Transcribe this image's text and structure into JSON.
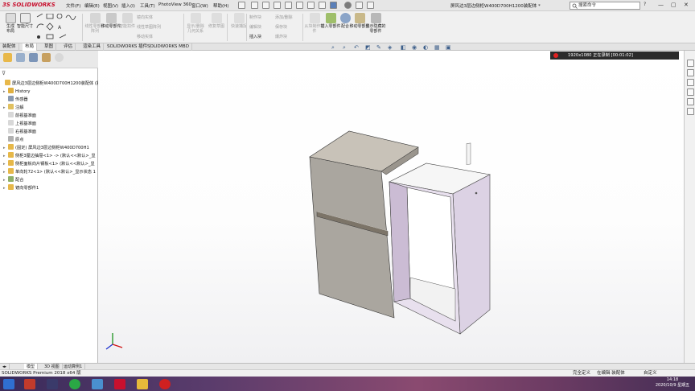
{
  "app": {
    "logo_ds": "3S",
    "logo_text": "SOLIDWORKS",
    "doc_title": "屏风边3层边侧柜W400D700H1200装配体 *",
    "search_placeholder": "搜索命令",
    "search_icon": "search-icon",
    "help_icon": "help-icon"
  },
  "menu": [
    "文件(F)",
    "编辑(E)",
    "视图(V)",
    "插入(I)",
    "工具(T)",
    "PhotoView 360",
    "窗口(W)",
    "帮助(H)"
  ],
  "window_controls": {
    "minimize": "—",
    "restore": "▢",
    "close": "✕"
  },
  "command_manager": {
    "sketch_tools": {
      "smart_dimension": "智能尺寸",
      "new_sketch_label": "生成\n布局"
    },
    "big_tools": [
      {
        "label": "智能尺寸",
        "state": "on"
      },
      {
        "label": "线性零部件阵列",
        "state": "off"
      },
      {
        "label": "移动零部件",
        "state": "off"
      },
      {
        "label": "智能扣件",
        "state": "off"
      },
      {
        "label": "爆炸视图",
        "state": "off"
      },
      {
        "label": "插入零部件",
        "state": "on"
      },
      {
        "label": "配合",
        "state": "on"
      },
      {
        "label": "移动零部件",
        "state": "on"
      },
      {
        "label": "显示隐藏的零部件",
        "state": "on"
      }
    ],
    "small_tools": {
      "mirror_entity": "镜向实体",
      "linear_sketch_pattern": "线性草图阵列",
      "move_entity": "移动实体",
      "show_hidden_lines": "显示/删除几何关系",
      "repair_sketch": "修复草图",
      "quick_snap": "快速捕捉",
      "rapid_sketch": "快速草图",
      "make_block": "制作块",
      "edit_block": "编辑块",
      "insert_block": "插入块",
      "add_relation": "添加/删除",
      "save_block": "保存块",
      "explode_block": "爆炸块",
      "from_file_make_part": "从块制作零件",
      "make_part": "制作零件",
      "insert_part": "插入零部件",
      "mate": "配合",
      "move_part": "移动零部件",
      "show_hidden": "显示隐藏的零部件"
    }
  },
  "tabs": [
    "装配体",
    "布局",
    "草图",
    "评估",
    "渲染工具",
    "SOLIDWORKS 插件",
    "SOLIDWORKS MBD"
  ],
  "active_tab": "布局",
  "feature_tree": [
    {
      "label": "屏风边3层边侧柜W400D700H1200装配体 (默",
      "indent": 0,
      "arrow": ""
    },
    {
      "label": "History",
      "indent": 1,
      "arrow": "▸"
    },
    {
      "label": "传感器",
      "indent": 1,
      "arrow": ""
    },
    {
      "label": "注解",
      "indent": 1,
      "arrow": "▸"
    },
    {
      "label": "前视基准面",
      "indent": 1,
      "arrow": ""
    },
    {
      "label": "上视基准面",
      "indent": 1,
      "arrow": ""
    },
    {
      "label": "右视基准面",
      "indent": 1,
      "arrow": ""
    },
    {
      "label": "原点",
      "indent": 1,
      "arrow": ""
    },
    {
      "label": "(固定) 屏风边3层边侧柜W400D700H1",
      "indent": 1,
      "arrow": "▸"
    },
    {
      "label": "侧柜3屋边抽屉<1> -> (默认<<默认>_显",
      "indent": 1,
      "arrow": "▸"
    },
    {
      "label": "侧柜面板向片钢板<1> (默认<<默认>_显",
      "indent": 1,
      "arrow": "▸"
    },
    {
      "label": "单向轮72<1> (默认<<默认>_显示状态 1",
      "indent": 1,
      "arrow": "▸"
    },
    {
      "label": "配合",
      "indent": 1,
      "arrow": "▸"
    },
    {
      "label": "镜向零部件1",
      "indent": 1,
      "arrow": "▸"
    }
  ],
  "recording": {
    "resolution": "1920x1080",
    "status": "正在录制",
    "time": "[00:01:02]"
  },
  "bottom_tabs": [
    "模型",
    "3D 视图",
    "运动算例1"
  ],
  "active_bottom_tab": "模型",
  "status": {
    "product": "SOLIDWORKS Premium 2018 x64 版",
    "constraint": "完全定义",
    "editing": "在编辑 装配体",
    "units": "自定义"
  },
  "clock": {
    "time": "14:18",
    "date": "2020/10/9 星期五"
  },
  "colors": {
    "panel_bg": "#f0f0f0",
    "cabinet_front": "#aaa69f",
    "cabinet_side_purple": "#cbbcd4",
    "cabinet_top": "#c8c2b8",
    "handle": "#7c7468",
    "triad_x": "#d01010",
    "triad_y": "#0a8a0a",
    "triad_z": "#1a2fd0"
  }
}
